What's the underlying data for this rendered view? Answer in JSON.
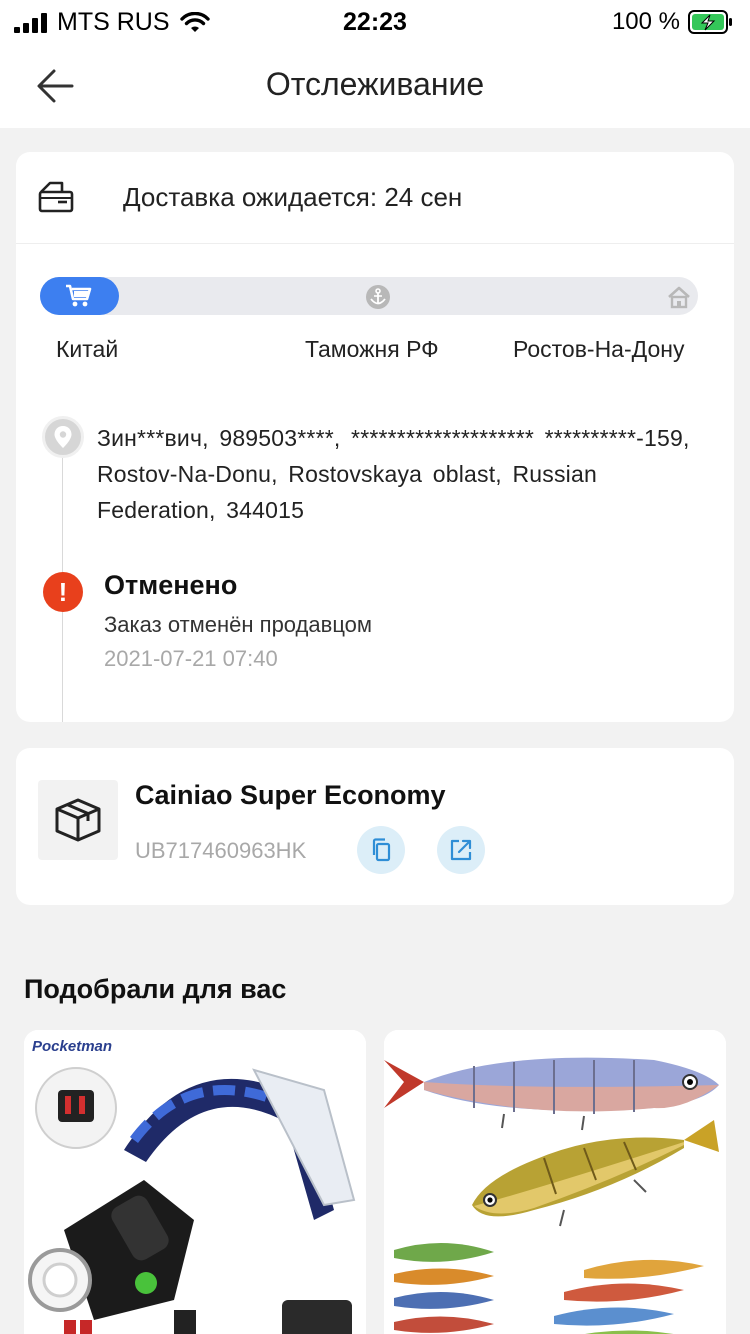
{
  "status_bar": {
    "carrier": "MTS RUS",
    "time": "22:23",
    "battery": "100 %"
  },
  "header": {
    "title": "Отслеживание"
  },
  "delivery": {
    "expected": "Доставка ожидается: 24 сен",
    "progress_fraction": 0.12,
    "stages": [
      "Китай",
      "Таможня РФ",
      "Ростов-На-Дону"
    ]
  },
  "address": {
    "text": "Зин***вич,  989503****,  ******************** **********-159,  Rostov-Na-Donu,  Rostovskaya oblast,  Russian Federation,  344015"
  },
  "status": {
    "title": "Отменено",
    "description": "Заказ отменён продавцом",
    "datetime": "2021-07-21 07:40"
  },
  "shipment": {
    "carrier": "Cainiao Super Economy",
    "tracking_number": "UB717460963HK"
  },
  "recommendations": {
    "title": "Подобрали для вас",
    "products": [
      {
        "brand": "Pocketman"
      },
      {
        "brand": ""
      }
    ]
  },
  "colors": {
    "accent": "#3d7ff0",
    "danger": "#e8401c",
    "soft_blue": "#dceef8",
    "muted_text": "#a8a8a8"
  },
  "icons": [
    "cellular-signal-icon",
    "wifi-icon",
    "battery-charging-icon",
    "back-arrow-icon",
    "truck-icon",
    "cart-icon",
    "anchor-icon",
    "home-icon",
    "location-pin-icon",
    "alert-icon",
    "package-box-icon",
    "copy-icon",
    "external-link-icon"
  ]
}
